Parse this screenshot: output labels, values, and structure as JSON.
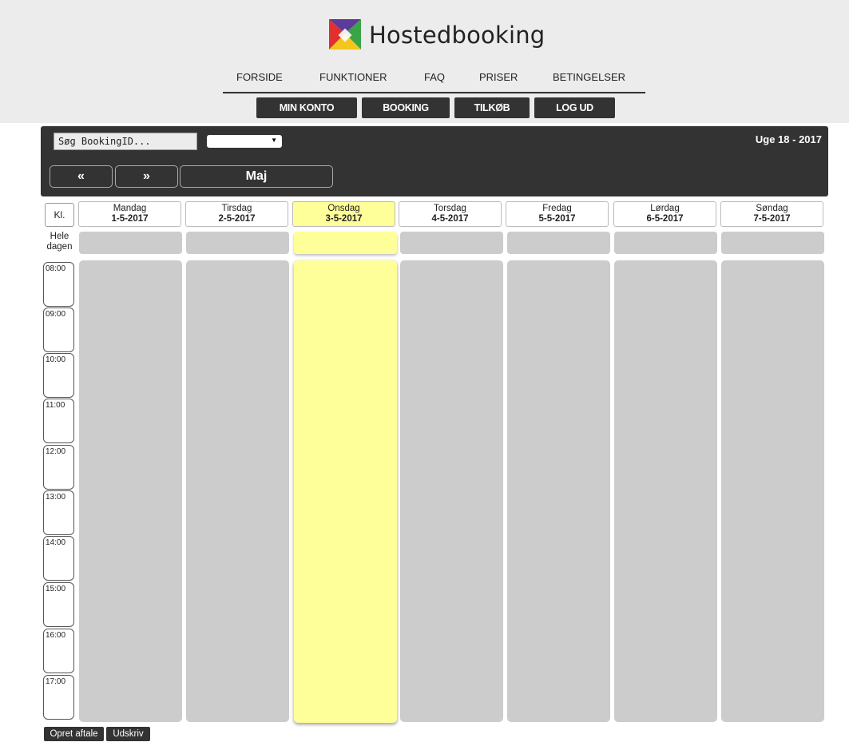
{
  "brand": {
    "name": "Hostedbooking"
  },
  "main_nav": [
    {
      "label": "FORSIDE"
    },
    {
      "label": "FUNKTIONER"
    },
    {
      "label": "FAQ"
    },
    {
      "label": "PRISER"
    },
    {
      "label": "BETINGELSER"
    }
  ],
  "sub_nav": [
    {
      "label": "MIN KONTO"
    },
    {
      "label": "BOOKING"
    },
    {
      "label": "TILKØB"
    },
    {
      "label": "LOG UD"
    }
  ],
  "calendar": {
    "search_placeholder": "Søg BookingID...",
    "select_value": "",
    "week_label": "Uge 18 - 2017",
    "prev_label": "«",
    "next_label": "»",
    "month_label": "Maj",
    "kl_label": "Kl.",
    "allday_label": "Hele dagen",
    "days": [
      {
        "name": "Mandag",
        "date": "1-5-2017"
      },
      {
        "name": "Tirsdag",
        "date": "2-5-2017"
      },
      {
        "name": "Onsdag",
        "date": "3-5-2017"
      },
      {
        "name": "Torsdag",
        "date": "4-5-2017"
      },
      {
        "name": "Fredag",
        "date": "5-5-2017"
      },
      {
        "name": "Lørdag",
        "date": "6-5-2017"
      },
      {
        "name": "Søndag",
        "date": "7-5-2017"
      }
    ],
    "today_index": 2,
    "hours": [
      "08:00",
      "09:00",
      "10:00",
      "11:00",
      "12:00",
      "13:00",
      "14:00",
      "15:00",
      "16:00",
      "17:00"
    ]
  },
  "actions": {
    "create_label": "Opret aftale",
    "print_label": "Udskriv"
  },
  "colors": {
    "dark": "#333333",
    "today": "#ffff99",
    "slot": "#cccccc",
    "header_bg": "#ececec"
  }
}
